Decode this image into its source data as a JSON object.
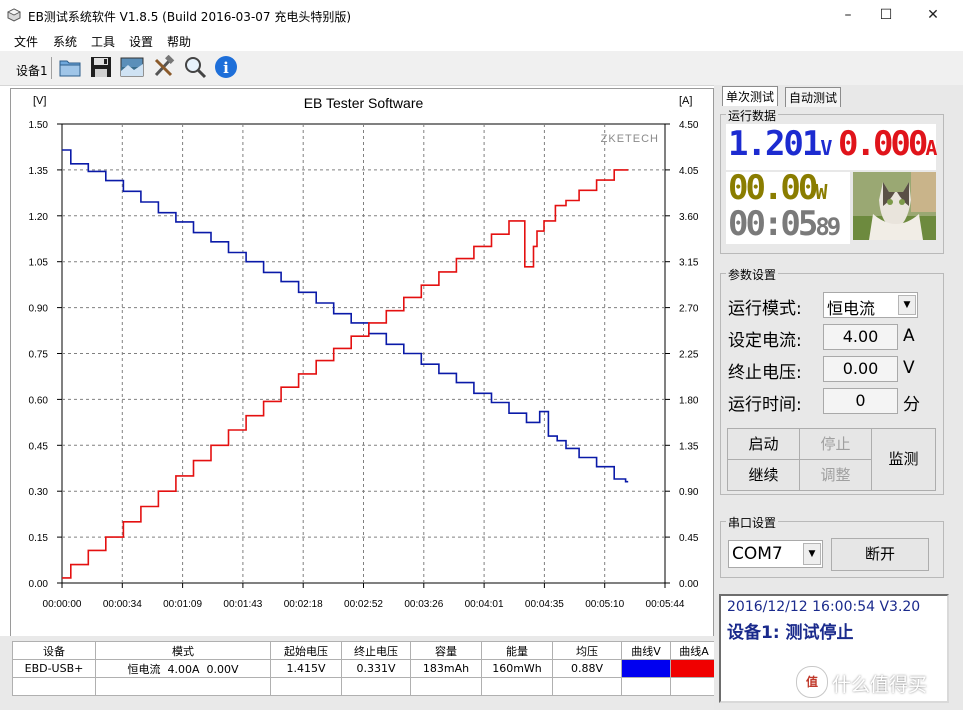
{
  "window": {
    "title": "EB测试系统软件 V1.8.5 (Build 2016-03-07 充电头特别版)",
    "controls": [
      "–",
      "☐",
      "✕"
    ]
  },
  "menu": [
    "文件",
    "系统",
    "工具",
    "设置",
    "帮助"
  ],
  "toolbar": {
    "device_label": "设备1",
    "icons": [
      "folder-icon",
      "save-icon",
      "image-icon",
      "tools-icon",
      "search-icon",
      "info-icon"
    ]
  },
  "chart_data": {
    "type": "line",
    "title": "EB Tester Software",
    "ylabel_left": "[V]",
    "ylabel_right": "[A]",
    "watermark": "ZKETECH",
    "x_ticks": [
      "00:00:00",
      "00:00:34",
      "00:01:09",
      "00:01:43",
      "00:02:18",
      "00:02:52",
      "00:03:26",
      "00:04:01",
      "00:04:35",
      "00:05:10",
      "00:05:44"
    ],
    "y_left_ticks": [
      "1.50",
      "1.35",
      "1.20",
      "1.05",
      "0.90",
      "0.75",
      "0.60",
      "0.45",
      "0.30",
      "0.15",
      "0.00"
    ],
    "y_right_ticks": [
      "4.50",
      "4.05",
      "3.60",
      "3.15",
      "2.70",
      "2.25",
      "1.80",
      "1.35",
      "0.90",
      "0.45",
      "0.00"
    ],
    "xlim_seconds": [
      0,
      344
    ],
    "ylim_left": [
      0,
      1.5
    ],
    "ylim_right": [
      0,
      4.5
    ],
    "grid": true,
    "series": [
      {
        "name": "曲线V",
        "axis": "left",
        "color": "#0a1aa8",
        "x": [
          0,
          10,
          20,
          30,
          40,
          50,
          60,
          70,
          80,
          90,
          100,
          110,
          120,
          130,
          140,
          150,
          160,
          170,
          180,
          190,
          200,
          210,
          220,
          230,
          240,
          250,
          260,
          270,
          275,
          280,
          285,
          290,
          300,
          310,
          320,
          323
        ],
        "y": [
          1.415,
          1.37,
          1.345,
          1.315,
          1.28,
          1.245,
          1.21,
          1.18,
          1.145,
          1.115,
          1.08,
          1.05,
          1.015,
          0.985,
          0.95,
          0.915,
          0.88,
          0.85,
          0.815,
          0.78,
          0.75,
          0.715,
          0.685,
          0.655,
          0.62,
          0.59,
          0.555,
          0.525,
          0.56,
          0.48,
          0.465,
          0.44,
          0.41,
          0.38,
          0.34,
          0.331
        ]
      },
      {
        "name": "曲线A",
        "axis": "right",
        "color": "#e41010",
        "x": [
          0,
          10,
          20,
          30,
          40,
          50,
          60,
          70,
          80,
          90,
          100,
          110,
          120,
          130,
          140,
          150,
          160,
          170,
          180,
          190,
          200,
          210,
          220,
          230,
          240,
          250,
          260,
          268,
          270,
          272,
          278,
          285,
          290,
          300,
          310,
          320,
          323
        ],
        "y": [
          0.05,
          0.18,
          0.32,
          0.45,
          0.6,
          0.75,
          0.9,
          1.05,
          1.2,
          1.35,
          1.5,
          1.64,
          1.78,
          1.92,
          2.05,
          2.18,
          2.3,
          2.42,
          2.55,
          2.67,
          2.8,
          2.92,
          3.05,
          3.18,
          3.3,
          3.42,
          3.55,
          3.1,
          3.3,
          3.45,
          3.55,
          3.7,
          3.75,
          3.85,
          3.95,
          4.05,
          4.05
        ]
      }
    ]
  },
  "table": {
    "headers": [
      "设备",
      "模式",
      "起始电压",
      "终止电压",
      "容量",
      "能量",
      "均压",
      "曲线V",
      "曲线A"
    ],
    "row": [
      "EBD-USB+",
      "恒电流  4.00A  0.00V",
      "1.415V",
      "0.331V",
      "183mAh",
      "160mWh",
      "0.88V",
      "",
      ""
    ],
    "curve_colors": [
      "#0000f0",
      "#f00000"
    ]
  },
  "right": {
    "tabs": [
      "单次测试",
      "自动测试"
    ],
    "run_data": {
      "label": "运行数据",
      "voltage": "1.201",
      "voltage_unit": "V",
      "current": "0.000",
      "current_unit": "A",
      "power": "00.00",
      "power_unit": "W",
      "time_main": "00:05",
      "time_sec": "89",
      "colors": {
        "voltage": "#1c2bd0",
        "current": "#e0141b",
        "power": "#8a7d00",
        "time": "#7a7a7a"
      }
    },
    "params": {
      "label": "参数设置",
      "mode_label": "运行模式:",
      "mode_value": "恒电流",
      "current_label": "设定电流:",
      "current_value": "4.00",
      "current_unit": "A",
      "cutoff_label": "终止电压:",
      "cutoff_value": "0.00",
      "cutoff_unit": "V",
      "runtime_label": "运行时间:",
      "runtime_value": "0",
      "runtime_unit": "分",
      "btn_start": "启动",
      "btn_stop": "停止",
      "btn_continue": "继续",
      "btn_adjust": "调整",
      "btn_monitor": "监测"
    },
    "serial": {
      "label": "串口设置",
      "port": "COM7",
      "disconnect": "断开"
    },
    "status": {
      "line1": "2016/12/12 16:00:54  V3.20",
      "line2": "设备1: 测试停止"
    },
    "watermark": "什么值得买"
  }
}
